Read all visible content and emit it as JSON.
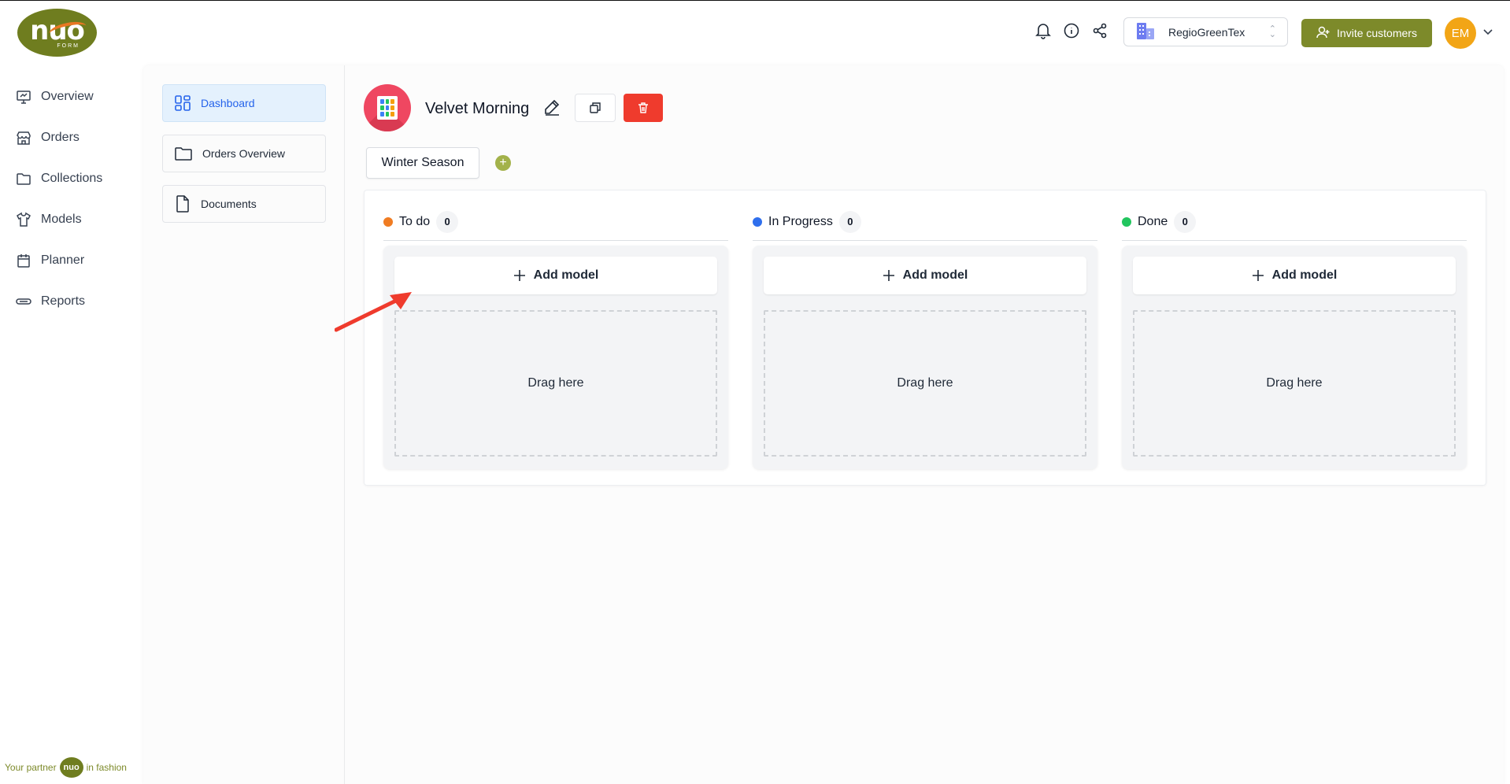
{
  "brand": {
    "logo_text": "nuo",
    "logo_sub": "FORM"
  },
  "header": {
    "org_name": "RegioGreenTex",
    "invite_label": "Invite customers",
    "avatar_initials": "EM"
  },
  "left_nav": {
    "items": [
      {
        "label": "Overview",
        "icon": "monitor-icon"
      },
      {
        "label": "Orders",
        "icon": "store-icon"
      },
      {
        "label": "Collections",
        "icon": "folder-icon"
      },
      {
        "label": "Models",
        "icon": "shirt-icon"
      },
      {
        "label": "Planner",
        "icon": "calendar-icon"
      },
      {
        "label": "Reports",
        "icon": "reports-icon"
      }
    ]
  },
  "footer": {
    "partner_prefix": "Your partner",
    "partner_logo": "nuo",
    "partner_suffix": "in fashion"
  },
  "sub_nav": {
    "items": [
      {
        "label": "Dashboard",
        "active": true
      },
      {
        "label": "Orders Overview",
        "active": false
      },
      {
        "label": "Documents",
        "active": false
      }
    ]
  },
  "project": {
    "title": "Velvet Morning",
    "tabs": [
      {
        "label": "Winter Season"
      }
    ]
  },
  "board": {
    "columns": [
      {
        "title": "To do",
        "count": "0",
        "color": "#f07c22",
        "add_label": "Add model",
        "drop_label": "Drag here"
      },
      {
        "title": "In Progress",
        "count": "0",
        "color": "#2f6fed",
        "add_label": "Add model",
        "drop_label": "Drag here"
      },
      {
        "title": "Done",
        "count": "0",
        "color": "#22c55e",
        "add_label": "Add model",
        "drop_label": "Drag here"
      }
    ]
  },
  "colors": {
    "brand_green": "#7d8a2a",
    "danger": "#ef3b2d",
    "avatar": "#f2a516"
  }
}
